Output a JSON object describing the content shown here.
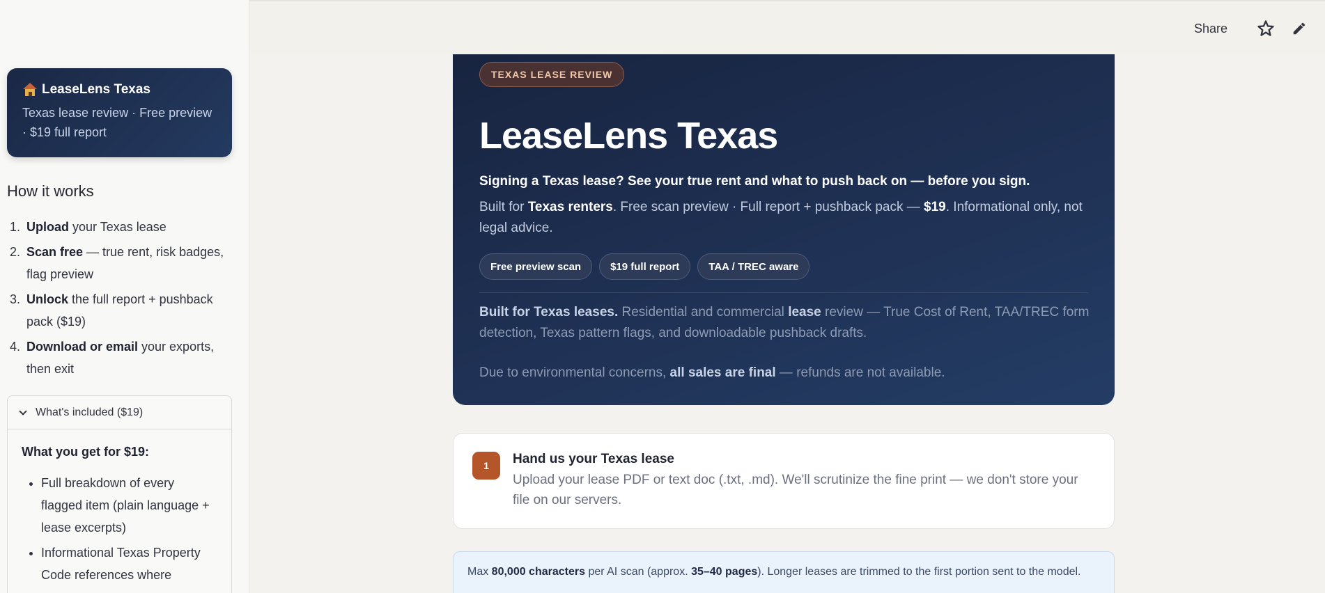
{
  "sidebar": {
    "brand_title": "LeaseLens Texas",
    "brand_subtitle": "Texas lease review · Free preview · $19 full report",
    "how_title": "How it works",
    "steps": [
      {
        "num": "1.",
        "bold": "Upload",
        "rest": " your Texas lease"
      },
      {
        "num": "2.",
        "bold": "Scan free",
        "rest": " — true rent, risk badges, flag preview"
      },
      {
        "num": "3.",
        "bold": "Unlock",
        "rest": " the full report + pushback pack ($19)"
      },
      {
        "num": "4.",
        "bold": "Download or email",
        "rest": " your exports, then exit"
      }
    ],
    "expander": {
      "label": "What's included ($19)",
      "lead": "What you get for $19:",
      "items": [
        "Full breakdown of every flagged item (plain language + lease excerpts)",
        "Informational Texas Property Code references where"
      ]
    }
  },
  "topbar": {
    "share_label": "Share"
  },
  "hero": {
    "pill": "TEXAS LEASE REVIEW",
    "title": "LeaseLens Texas",
    "tagline": "Signing a Texas lease? See your true rent and what to push back on — before you sign.",
    "desc_parts": [
      "Built for ",
      "Texas renters",
      ". Free scan preview · Full report + pushback pack — ",
      "$19",
      ". Informational only, not legal advice."
    ],
    "chips": [
      "Free preview scan",
      "$19 full report",
      "TAA / TREC aware"
    ],
    "para_parts": [
      "Built for Texas leases.",
      " Residential and commercial ",
      "lease",
      " review — True Cost of Rent, TAA/TREC form detection, Texas pattern flags, and downloadable pushback drafts."
    ],
    "para2_parts": [
      "Due to environmental concerns, ",
      "all sales are final",
      " — refunds are not available."
    ]
  },
  "step": {
    "num": "1",
    "title": "Hand us your Texas lease",
    "desc": "Upload your lease PDF or text doc (.txt, .md). We'll scrutinize the fine print — we don't store your file on our servers."
  },
  "info": {
    "parts": [
      "Max ",
      "80,000 characters",
      " per AI scan (approx. ",
      "35–40 pages",
      "). Longer leases are trimmed to the first portion sent to the model."
    ]
  }
}
